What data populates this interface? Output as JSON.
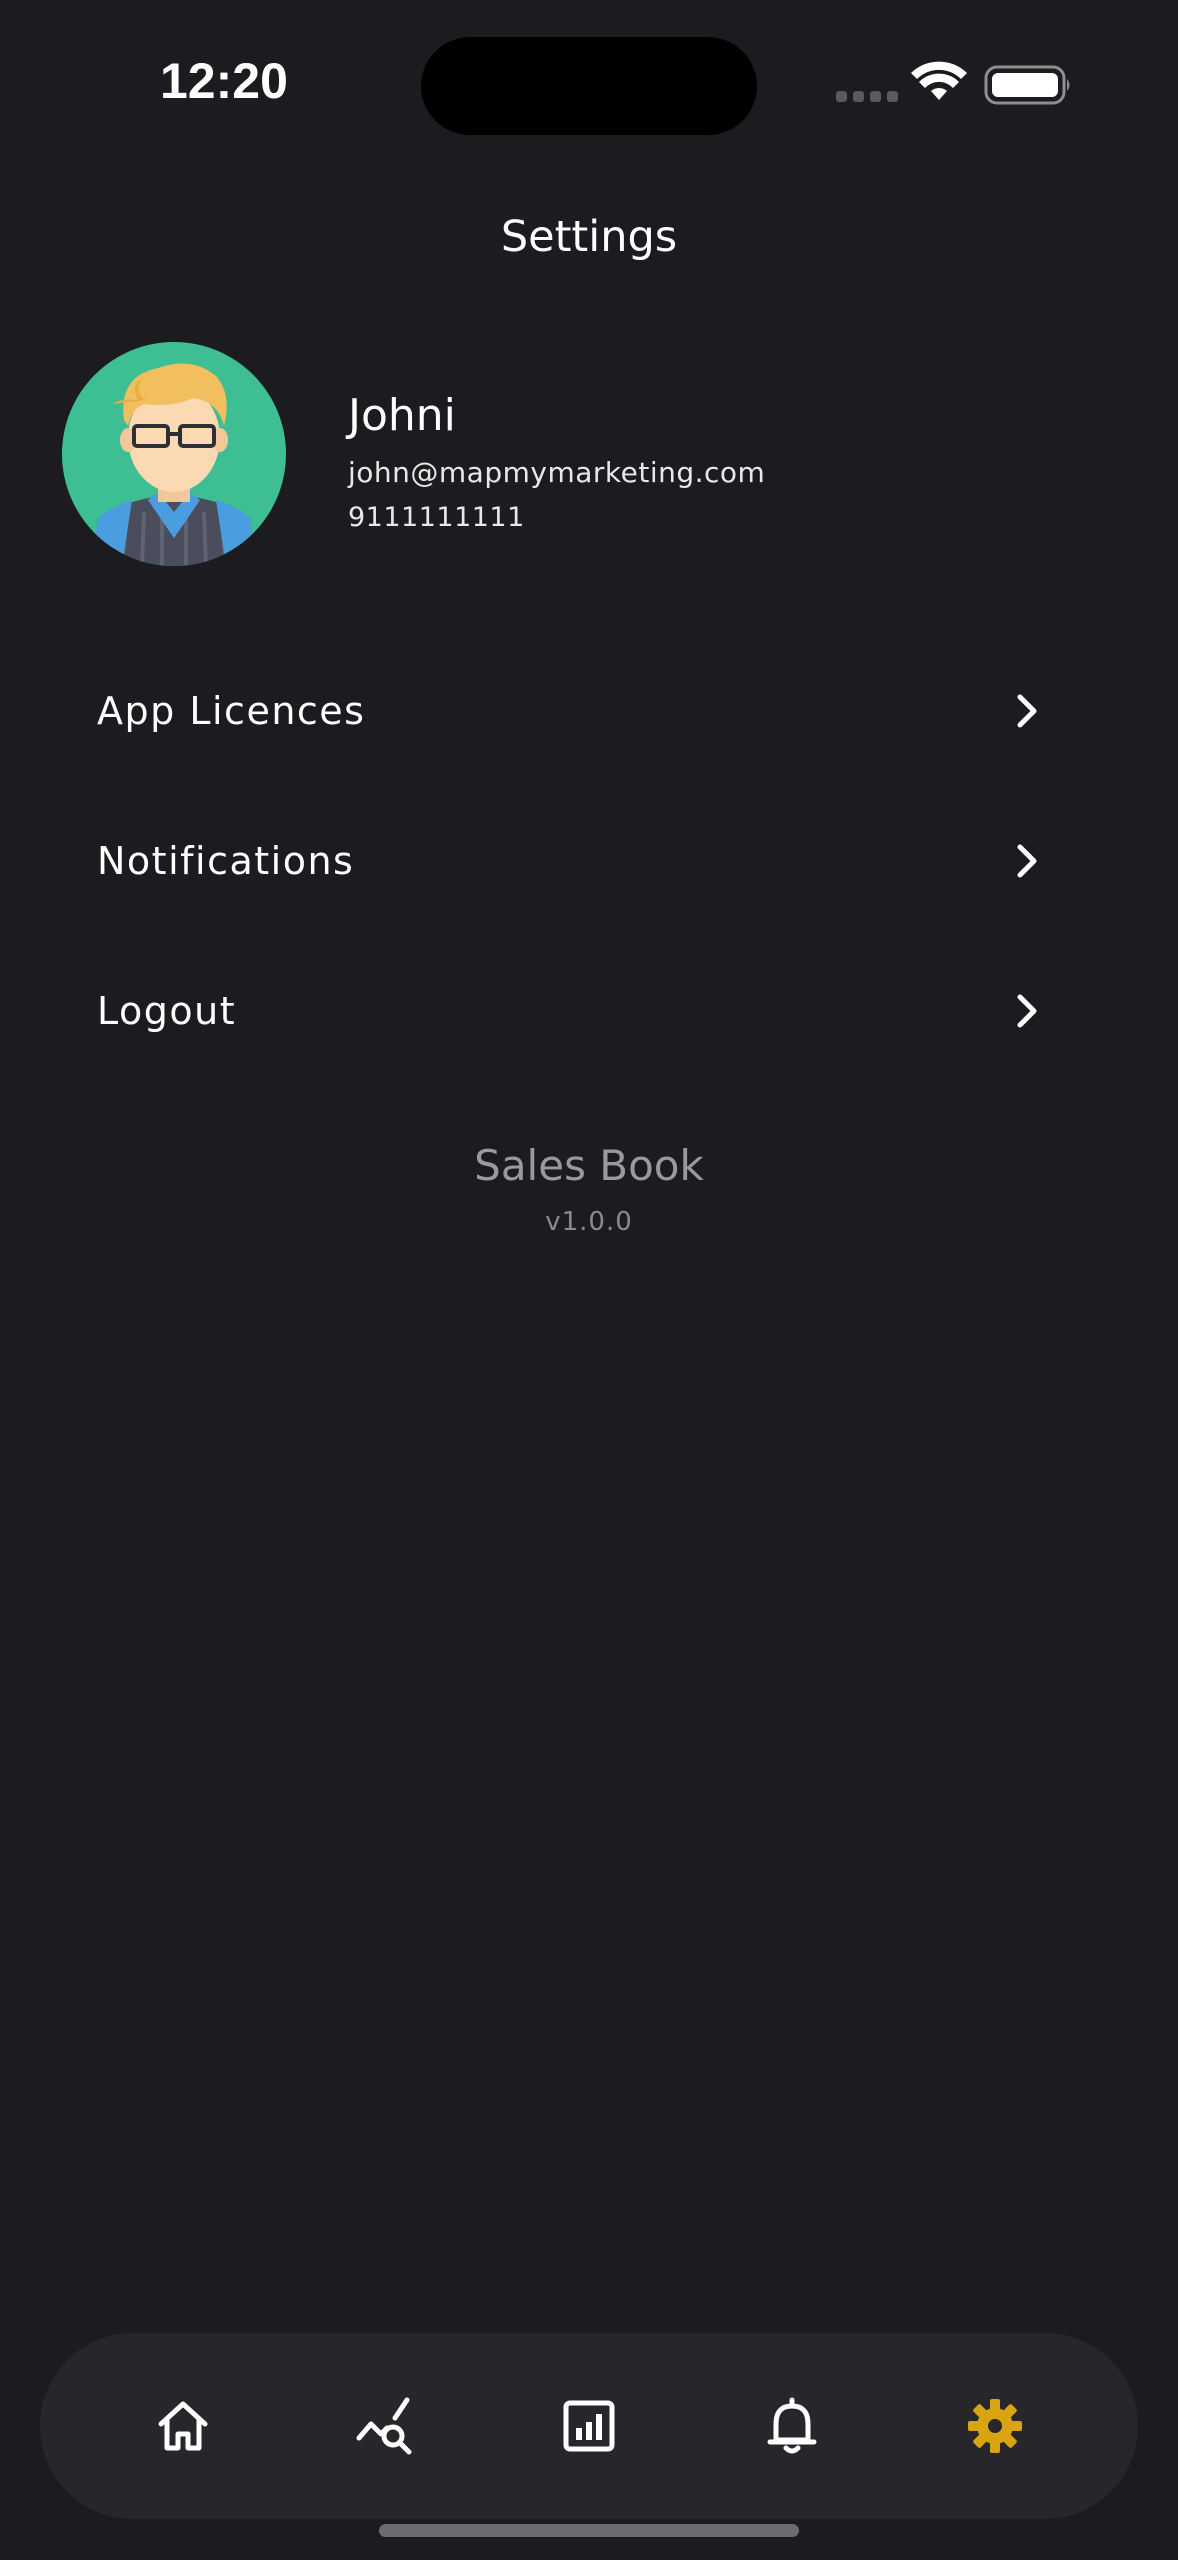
{
  "status_bar": {
    "time": "12:20"
  },
  "header": {
    "title": "Settings"
  },
  "profile": {
    "name": "Johni",
    "email": "john@mapmymarketing.com",
    "phone": "9111111111"
  },
  "menu": {
    "items": [
      {
        "label": "App Licences",
        "icon": "chevron-right-icon"
      },
      {
        "label": "Notifications",
        "icon": "chevron-right-icon"
      },
      {
        "label": "Logout",
        "icon": "chevron-right-icon"
      }
    ]
  },
  "app_info": {
    "name": "Sales Book",
    "version": "v1.0.0"
  },
  "bottom_nav": {
    "items": [
      {
        "icon": "home-icon",
        "active": false
      },
      {
        "icon": "chart-search-icon",
        "active": false
      },
      {
        "icon": "report-icon",
        "active": false
      },
      {
        "icon": "bell-icon",
        "active": false
      },
      {
        "icon": "gear-icon",
        "active": true
      }
    ]
  },
  "colors": {
    "background": "#1c1b1f",
    "nav_background": "#27272b",
    "active_accent": "#d8a412",
    "inactive_icon": "#ffffff",
    "muted_text": "#9a9a9e",
    "avatar_background": "#3dbf93"
  }
}
